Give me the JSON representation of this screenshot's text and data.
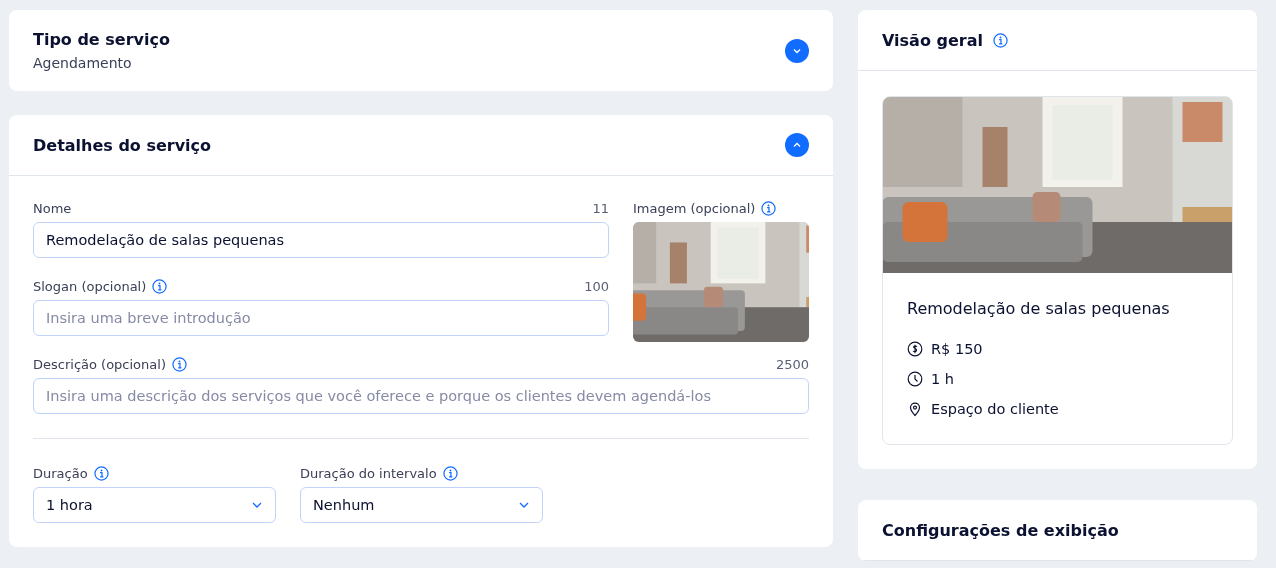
{
  "service_type": {
    "title": "Tipo de serviço",
    "value": "Agendamento",
    "expanded": false
  },
  "service_details": {
    "title": "Detalhes do serviço",
    "expanded": true,
    "name": {
      "label": "Nome",
      "count": "11",
      "value": "Remodelação de salas pequenas"
    },
    "image": {
      "label": "Imagem (opcional)",
      "kind": "picture"
    },
    "slogan": {
      "label": "Slogan (opcional)",
      "count": "100",
      "placeholder": "Insira uma breve introdução"
    },
    "description": {
      "label": "Descrição (opcional)",
      "count": "2500",
      "placeholder": "Insira uma descrição dos serviços que você oferece e porque os clientes devem agendá-los"
    },
    "duration": {
      "label": "Duração",
      "value": "1 hora"
    },
    "interval": {
      "label": "Duração do intervalo",
      "value": "Nenhum"
    }
  },
  "overview": {
    "title": "Visão geral",
    "preview": {
      "name": "Remodelação de salas pequenas",
      "details": [
        {
          "kind": "price",
          "text": "R$ 150"
        },
        {
          "kind": "duration",
          "text": "1 h"
        },
        {
          "kind": "location",
          "text": "Espaço do cliente"
        }
      ]
    }
  },
  "display_settings": {
    "title": "Configurações de exibição"
  }
}
